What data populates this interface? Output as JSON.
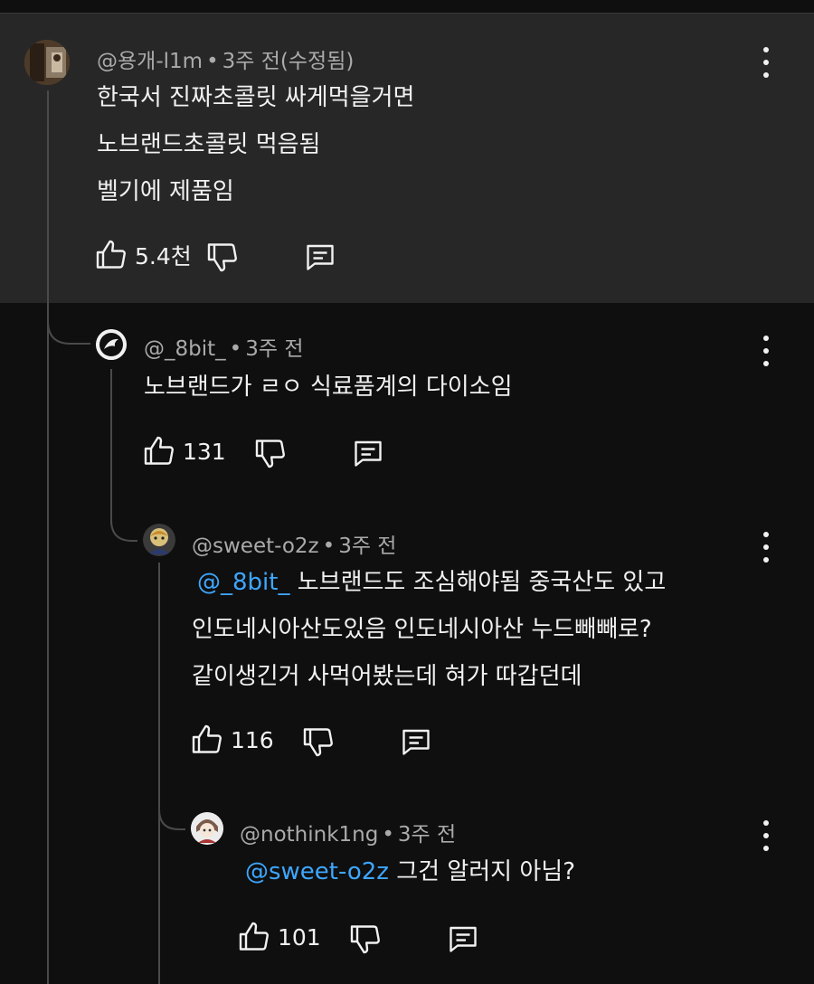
{
  "comments": [
    {
      "author": "@용개-l1m",
      "time": "3주 전(수정됨)",
      "lines": [
        "한국서 진짜초콜릿 싸게먹을거면",
        "노브랜드초콜릿 먹음됨",
        "벨기에 제품임"
      ],
      "likes": "5.4천"
    },
    {
      "author": "@_8bit_",
      "time": "3주 전",
      "lines": [
        "노브랜드가 ㄹㅇ 식료품계의 다이소임"
      ],
      "likes": "131"
    },
    {
      "author": "@sweet-o2z",
      "time": "3주 전",
      "mention": "@_8bit_",
      "lines": [
        " 노브랜드도 조심해야됨 중국산도 있고",
        "인도네시아산도있음 인도네시아산 누드빼빼로?",
        "같이생긴거 사먹어봤는데 혀가 따갑던데"
      ],
      "likes": "116"
    },
    {
      "author": "@nothink1ng",
      "time": "3주 전",
      "mention": "@sweet-o2z",
      "lines": [
        " 그건 알러지 아님?"
      ],
      "likes": "101"
    }
  ],
  "meta_separator": "•",
  "icons": {
    "like": "thumbs-up-icon",
    "dislike": "thumbs-down-icon",
    "reply": "reply-comment-icon",
    "menu": "more-vert-icon"
  },
  "colors": {
    "background": "#0f0f0f",
    "highlight": "#272727",
    "mention": "#3ea6ff",
    "meta": "#aaaaaa"
  }
}
